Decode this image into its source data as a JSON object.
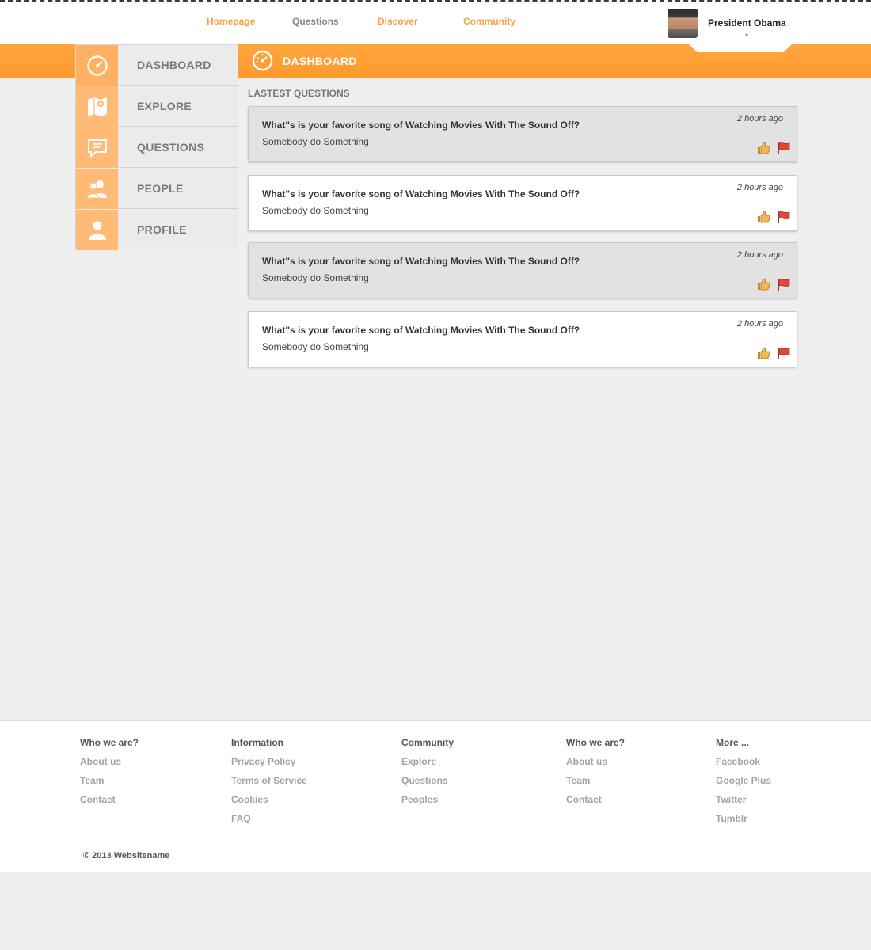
{
  "topnav": {
    "homepage": "Homepage",
    "questions": "Questions",
    "discover": "Discover",
    "community": "Community"
  },
  "user": {
    "name": "President Obama"
  },
  "header": {
    "title": "DASHBOARD"
  },
  "sidebar": {
    "items": [
      {
        "label": "DASHBOARD",
        "icon": "speedometer-icon"
      },
      {
        "label": "EXPLORE",
        "icon": "map-icon"
      },
      {
        "label": "QUESTIONS",
        "icon": "chat-bubble-icon"
      },
      {
        "label": "PEOPLE",
        "icon": "people-icon"
      },
      {
        "label": "PROFILE",
        "icon": "person-icon"
      }
    ]
  },
  "main": {
    "section_title": "LASTEST QUESTIONS",
    "questions": [
      {
        "title": "What\"s is your favorite song of Watching Movies With The Sound Off?",
        "subtitle": "Somebody do Something",
        "time": "2 hours ago"
      },
      {
        "title": "What\"s is your favorite song of Watching Movies With The Sound Off?",
        "subtitle": "Somebody do Something",
        "time": "2 hours ago"
      },
      {
        "title": "What\"s is your favorite song of Watching Movies With The Sound Off?",
        "subtitle": "Somebody do Something",
        "time": "2 hours ago"
      },
      {
        "title": "What\"s is your favorite song of Watching Movies With The Sound Off?",
        "subtitle": "Somebody do Something",
        "time": "2 hours ago"
      }
    ]
  },
  "footer": {
    "columns": [
      {
        "heading": "Who we are?",
        "links": [
          "About us",
          "Team",
          "Contact"
        ]
      },
      {
        "heading": "Information",
        "links": [
          "Privacy Policy",
          "Terms of Service",
          "Cookies",
          "FAQ"
        ]
      },
      {
        "heading": "Community",
        "links": [
          "Explore",
          "Questions",
          "Peoples"
        ]
      },
      {
        "heading": "Who we are?",
        "links": [
          "About us",
          "Team",
          "Contact"
        ]
      },
      {
        "heading": "More ...",
        "links": [
          "Facebook",
          "Google Plus",
          "Twitter",
          "Tumblr"
        ]
      }
    ],
    "copyright": "© 2013 Websitename"
  },
  "colors": {
    "accent": "#ff9d32",
    "sidebar_icon_bg": "#ffbb75",
    "nav_active": "#f7a043"
  }
}
